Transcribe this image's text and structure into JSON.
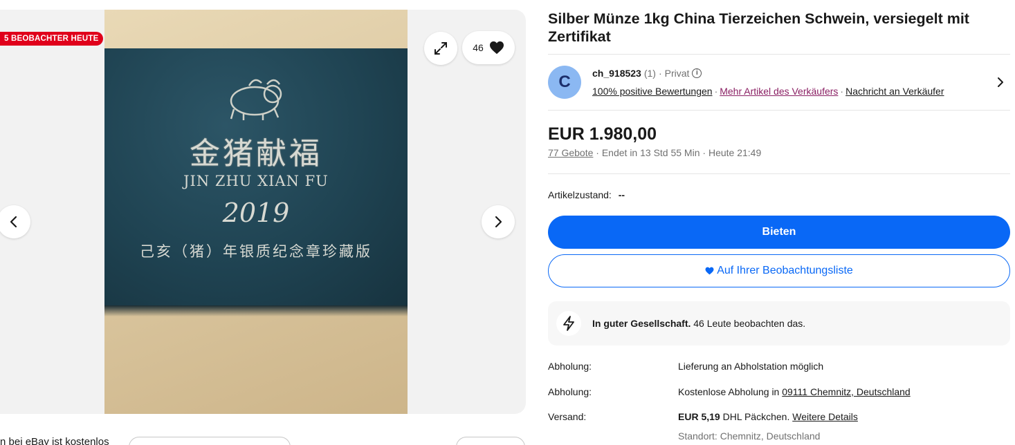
{
  "gallery": {
    "watchers_badge": "5 BEOBACHTER HEUTE",
    "watch_count": "46",
    "photo_text": {
      "chinese_title": "金猪献福",
      "pinyin": "JIN ZHU XIAN FU",
      "year": "2019",
      "subtitle": "己亥（猪）年银质纪念章珍藏版"
    }
  },
  "bottom": {
    "partial_text": "n bei eBay ist kostenlos"
  },
  "listing": {
    "title": "Silber Münze 1kg China Tierzeichen Schwein, versiegelt mit Zertifikat",
    "seller": {
      "avatar_letter": "C",
      "name": "ch_918523",
      "rating_count": "(1)",
      "type": "Privat",
      "positive": "100% positive Bewertungen",
      "more_items": "Mehr Artikel des Verkäufers",
      "contact": "Nachricht an Verkäufer"
    },
    "price": "EUR 1.980,00",
    "bids": "77 Gebote",
    "ends_in": "Endet in 13 Std 55 Min",
    "ends_at": "Heute 21:49",
    "condition_label": "Artikelzustand:",
    "condition_value": "--",
    "bid_button": "Bieten",
    "watch_button": "Auf Ihrer Beobachtungsliste",
    "social": {
      "bold": "In guter Gesellschaft.",
      "text": "46 Leute beobachten das."
    },
    "details": {
      "pickup1_label": "Abholung:",
      "pickup1_value": "Lieferung an Abholstation möglich",
      "pickup2_label": "Abholung:",
      "pickup2_prefix": "Kostenlose Abholung in",
      "pickup2_link": "09111 Chemnitz, Deutschland",
      "shipping_label": "Versand:",
      "shipping_price": "EUR 5,19",
      "shipping_method": "DHL Päckchen.",
      "shipping_link": "Weitere Details",
      "location": "Standort: Chemnitz, Deutschland"
    }
  },
  "colors": {
    "accent_blue": "#0968f6",
    "badge_red": "#e0001b",
    "link_purple": "#8a1f63",
    "avatar_bg": "#8bb8f2"
  },
  "icons": [
    "expand-icon",
    "heart-icon",
    "chevron-left-icon",
    "chevron-right-icon",
    "info-icon",
    "lightning-icon"
  ]
}
